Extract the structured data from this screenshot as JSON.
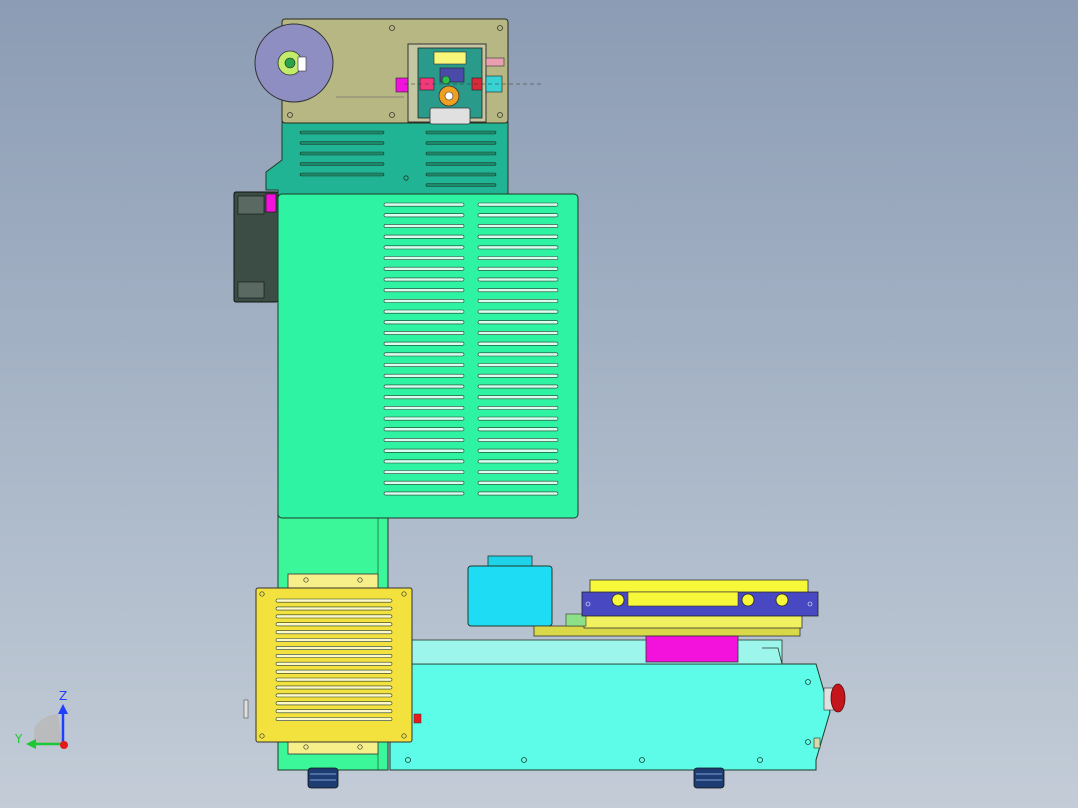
{
  "colors": {
    "background_top": "#8c9cb4",
    "background_bottom": "#c3ccd7",
    "spool_holder": "#b6b783",
    "spool": "#8e8ec3",
    "spool_hub": "#c2ec6a",
    "upper_housing": "#20b494",
    "front_cover": "#2ef3a2",
    "column": "#3cf799",
    "rear_box": "#3b4d44",
    "left_grille_box": "#f3e23d",
    "base": "#5cfce8",
    "top_motor": "#1edcf3",
    "slide_frame": "#4848c2",
    "slide_rail": "#f8f83b",
    "slide_plate": "#d8d848",
    "magenta_block": "#f312dc",
    "emergency_stop": "#c4141c",
    "foot": "#1c3c72",
    "outline": "#1f3a2a"
  },
  "axis_triad": {
    "z_label": "Z",
    "y_label": "Y",
    "z_color": "#1f3fff",
    "y_color": "#19c832",
    "origin_color": "#e51a1a"
  }
}
